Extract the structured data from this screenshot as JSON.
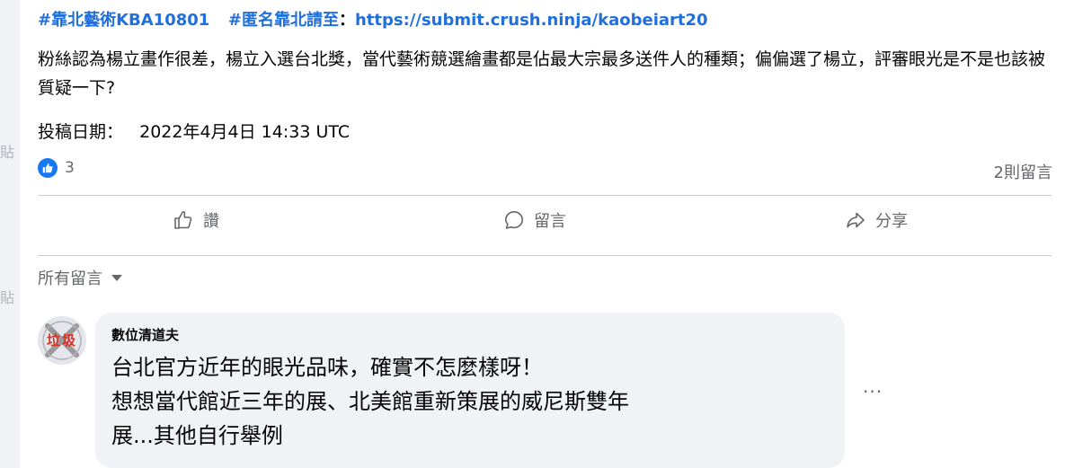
{
  "gutter": {
    "char1": "貼",
    "char2": "貼"
  },
  "post": {
    "hashtag1": "#靠北藝術KBA10801",
    "hashtag2": "#匿名靠北請至",
    "colon": "：",
    "submit_url": "https://submit.crush.ninja/kaobeiart20",
    "body": "粉絲認為楊立畫作很差，楊立入選台北獎，當代藝術競選繪畫都是佔最大宗最多送件人的種類；偏偏選了楊立，評審眼光是不是也該被質疑一下?",
    "date_label": "投稿日期：",
    "date_value": "2022年4月4日 14:33 UTC",
    "reaction_count": "3",
    "comment_count": "2則留言"
  },
  "actions": {
    "like": "讚",
    "comment": "留言",
    "share": "分享"
  },
  "comments": {
    "sort_label": "所有留言",
    "avatar_text": "垃圾",
    "items": [
      {
        "author": "數位清道夫",
        "line1": "台北官方近年的眼光品味，確實不怎麼樣呀！",
        "line2": "想想當代館近三年的展、北美館重新策展的威尼斯雙年",
        "line3": "展...其他自行舉例"
      }
    ],
    "more_label": "···"
  },
  "colors": {
    "link": "#216fdb",
    "brand": "#1877f2",
    "secondary_text": "#65676b",
    "bubble": "#f0f2f5"
  }
}
